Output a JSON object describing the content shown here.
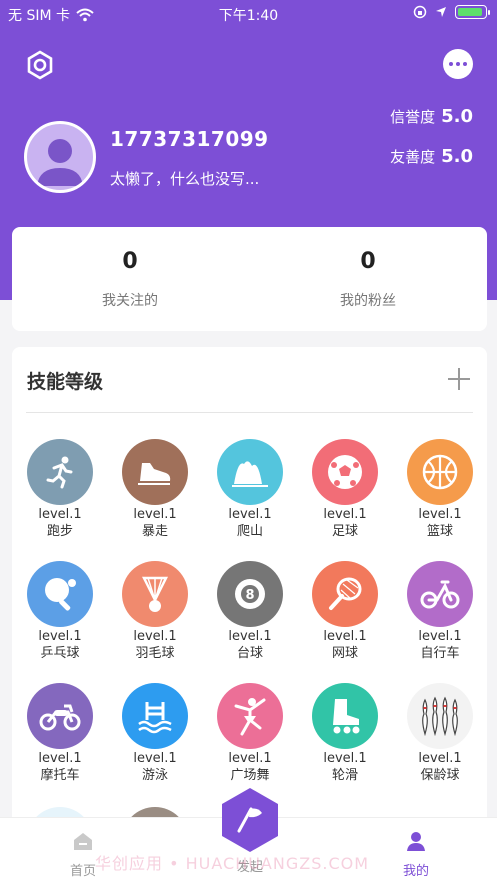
{
  "status_bar": {
    "carrier": "无 SIM 卡",
    "time": "下午1:40"
  },
  "profile": {
    "phone": "17737317099",
    "bio": "太懒了，什么也没写...",
    "credit_label": "信誉度",
    "credit_value": "5.0",
    "friendly_label": "友善度",
    "friendly_value": "5.0"
  },
  "follow": {
    "following_count": "0",
    "following_label": "我关注的",
    "fans_count": "0",
    "fans_label": "我的粉丝"
  },
  "skills": {
    "title": "技能等级",
    "items": [
      {
        "level": "level.1",
        "name": "跑步",
        "icon": "running-icon",
        "color": "#7f9db1"
      },
      {
        "level": "level.1",
        "name": "暴走",
        "icon": "sneaker-icon",
        "color": "#a0705a"
      },
      {
        "level": "level.1",
        "name": "爬山",
        "icon": "mountain-icon",
        "color": "#54c5dd"
      },
      {
        "level": "level.1",
        "name": "足球",
        "icon": "soccer-icon",
        "color": "#f26d77"
      },
      {
        "level": "level.1",
        "name": "篮球",
        "icon": "basketball-icon",
        "color": "#f59b4b"
      },
      {
        "level": "level.1",
        "name": "乒乓球",
        "icon": "pingpong-icon",
        "color": "#5c9fe6"
      },
      {
        "level": "level.1",
        "name": "羽毛球",
        "icon": "badminton-icon",
        "color": "#f08a6e"
      },
      {
        "level": "level.1",
        "name": "台球",
        "icon": "billiards-icon",
        "color": "#767676"
      },
      {
        "level": "level.1",
        "name": "网球",
        "icon": "tennis-icon",
        "color": "#f2795c"
      },
      {
        "level": "level.1",
        "name": "自行车",
        "icon": "bike-icon",
        "color": "#b26cc9"
      },
      {
        "level": "level.1",
        "name": "摩托车",
        "icon": "motorcycle-icon",
        "color": "#8468be"
      },
      {
        "level": "level.1",
        "name": "游泳",
        "icon": "swimming-icon",
        "color": "#2d9cf0"
      },
      {
        "level": "level.1",
        "name": "广场舞",
        "icon": "dance-icon",
        "color": "#ec6f97"
      },
      {
        "level": "level.1",
        "name": "轮滑",
        "icon": "rollerskate-icon",
        "color": "#31c4a7"
      },
      {
        "level": "level.1",
        "name": "保龄球",
        "icon": "bowling-icon",
        "color": "#f3f3f3"
      }
    ]
  },
  "tabbar": {
    "home": "首页",
    "launch": "发起",
    "mine": "我的",
    "accent": "#7d4fd6"
  },
  "watermark": "华创应用 • HUACHUANGZS.COM"
}
